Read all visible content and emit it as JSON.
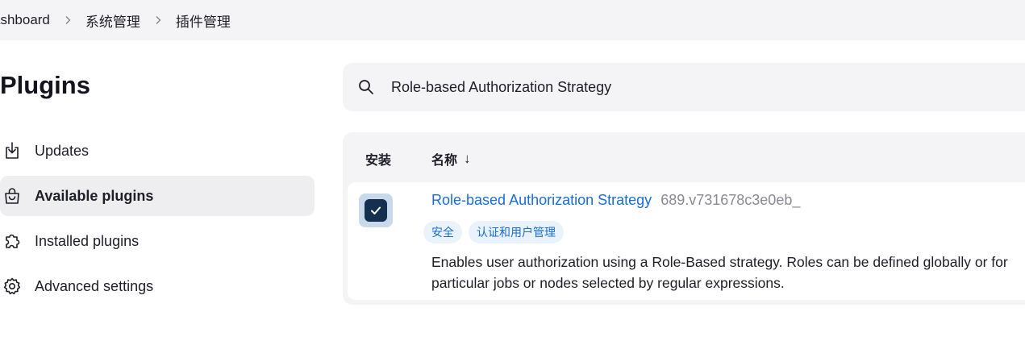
{
  "breadcrumb": {
    "items": [
      "ashboard",
      "系统管理",
      "插件管理"
    ]
  },
  "page": {
    "title": "Plugins"
  },
  "sidebar": {
    "items": [
      {
        "label": "Updates",
        "icon": "download-icon",
        "active": false
      },
      {
        "label": "Available plugins",
        "icon": "shopping-bag-icon",
        "active": true
      },
      {
        "label": "Installed plugins",
        "icon": "puzzle-icon",
        "active": false
      },
      {
        "label": "Advanced settings",
        "icon": "gear-icon",
        "active": false
      }
    ]
  },
  "search": {
    "value": "Role-based Authorization Strategy",
    "icon": "search-icon"
  },
  "table": {
    "columns": {
      "install": "安装",
      "name": "名称",
      "sort_indicator": "↓"
    },
    "rows": [
      {
        "checked": true,
        "name": "Role-based Authorization Strategy",
        "version": "689.v731678c3e0eb_",
        "tags": [
          "安全",
          "认证和用户管理"
        ],
        "description": "Enables user authorization using a Role-Based strategy. Roles can be defined globally or for particular jobs or nodes selected by regular expressions."
      }
    ]
  },
  "colors": {
    "link": "#1a6dd6",
    "checkbox": "#15304f",
    "panel": "#f4f4f6"
  }
}
